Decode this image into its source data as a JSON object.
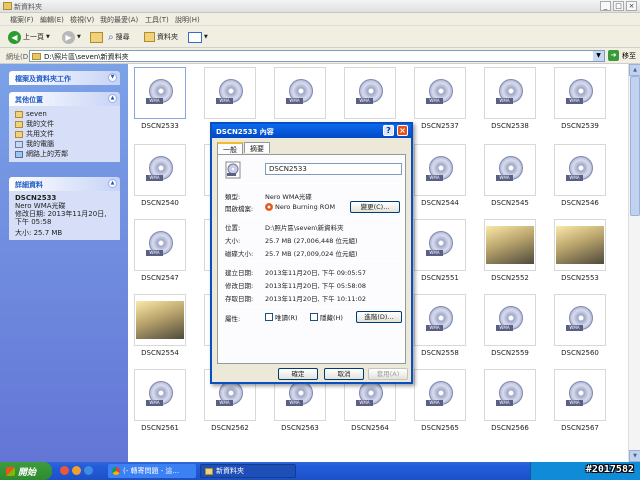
{
  "window": {
    "title": "新資料夾",
    "min": "_",
    "max": "□",
    "close": "×"
  },
  "menu": [
    "檔案(F)",
    "編輯(E)",
    "檢視(V)",
    "我的最愛(A)",
    "工具(T)",
    "說明(H)"
  ],
  "toolbar": {
    "back": "上一頁",
    "search": "搜尋",
    "folders": "資料夾"
  },
  "address": {
    "label": "網址(D)",
    "value": "D:\\照片區\\seven\\新資料夾",
    "go": "移至"
  },
  "sidebar": {
    "tasks_title": "檔案及資料夾工作",
    "places_title": "其他位置",
    "places": [
      "seven",
      "我的文件",
      "共用文件",
      "我的電腦",
      "網路上的芳鄰"
    ],
    "details_title": "詳細資料",
    "details_name": "DSCN2533",
    "details_type": "Nero WMA光碟",
    "details_modified": "修改日期: 2013年11月20日, 下午 05:58",
    "details_size": "大小: 25.7 MB"
  },
  "files": [
    {
      "name": "DSCN2533",
      "kind": "wma"
    },
    {
      "name": "",
      "kind": "wma"
    },
    {
      "name": "",
      "kind": "wma"
    },
    {
      "name": "",
      "kind": "wma"
    },
    {
      "name": "DSCN2537",
      "kind": "wma"
    },
    {
      "name": "DSCN2538",
      "kind": "wma"
    },
    {
      "name": "DSCN2539",
      "kind": "wma"
    },
    {
      "name": "DSCN2540",
      "kind": "wma"
    },
    {
      "name": "",
      "kind": "wma"
    },
    {
      "name": "",
      "kind": "wma"
    },
    {
      "name": "",
      "kind": "wma"
    },
    {
      "name": "DSCN2544",
      "kind": "wma"
    },
    {
      "name": "DSCN2545",
      "kind": "wma"
    },
    {
      "name": "DSCN2546",
      "kind": "wma"
    },
    {
      "name": "DSCN2547",
      "kind": "wma"
    },
    {
      "name": "",
      "kind": "wma"
    },
    {
      "name": "",
      "kind": "wma"
    },
    {
      "name": "",
      "kind": "wma"
    },
    {
      "name": "DSCN2551",
      "kind": "wma"
    },
    {
      "name": "DSCN2552",
      "kind": "photo"
    },
    {
      "name": "DSCN2553",
      "kind": "photo"
    },
    {
      "name": "DSCN2554",
      "kind": "photo"
    },
    {
      "name": "",
      "kind": "wma"
    },
    {
      "name": "",
      "kind": "wma"
    },
    {
      "name": "",
      "kind": "wma"
    },
    {
      "name": "DSCN2558",
      "kind": "wma"
    },
    {
      "name": "DSCN2559",
      "kind": "wma"
    },
    {
      "name": "DSCN2560",
      "kind": "wma"
    },
    {
      "name": "DSCN2561",
      "kind": "wma"
    },
    {
      "name": "DSCN2562",
      "kind": "wma"
    },
    {
      "name": "DSCN2563",
      "kind": "wma"
    },
    {
      "name": "DSCN2564",
      "kind": "wma"
    },
    {
      "name": "DSCN2565",
      "kind": "wma"
    },
    {
      "name": "DSCN2566",
      "kind": "wma"
    },
    {
      "name": "DSCN2567",
      "kind": "wma"
    }
  ],
  "dialog": {
    "title": "DSCN2533 內容",
    "tabs": [
      "一般",
      "摘要"
    ],
    "filename": "DSCN2533",
    "rows": [
      {
        "label": "類型:",
        "value": "Nero WMA光碟"
      },
      {
        "label": "開啟檔案:",
        "value": "Nero Burning ROM"
      },
      {
        "label": "位置:",
        "value": "D:\\照片區\\seven\\新資料夾"
      },
      {
        "label": "大小:",
        "value": "25.7 MB (27,006,448 位元組)"
      },
      {
        "label": "磁碟大小:",
        "value": "25.7 MB (27,009,024 位元組)"
      },
      {
        "label": "建立日期:",
        "value": "2013年11月20日, 下午 09:05:57"
      },
      {
        "label": "修改日期:",
        "value": "2013年11月20日, 下午 05:58:08"
      },
      {
        "label": "存取日期:",
        "value": "2013年11月20日, 下午 10:11:02"
      }
    ],
    "change_btn": "變更(C)...",
    "attr_label": "屬性:",
    "readonly": "唯讀(R)",
    "hidden": "隱藏(H)",
    "advanced": "進階(D)...",
    "ok": "確定",
    "cancel": "取消",
    "apply": "套用(A)"
  },
  "taskbar": {
    "start": "開始",
    "task1": "(- 轉寄問題 - 這...",
    "task2": "新資料夾",
    "watermark": "#2017582"
  }
}
